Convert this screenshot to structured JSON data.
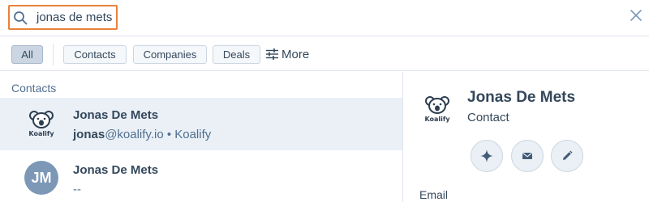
{
  "search": {
    "query": "jonas de mets"
  },
  "filters": {
    "all": "All",
    "contacts": "Contacts",
    "companies": "Companies",
    "deals": "Deals",
    "more": "More"
  },
  "results": {
    "section_label": "Contacts",
    "items": [
      {
        "name": "Jonas De Mets",
        "email_user": "jonas",
        "email_rest": "@koalify.io • Koalify",
        "logo_text": "Koalify",
        "selected": true
      },
      {
        "name": "Jonas De Mets",
        "subtitle": "--",
        "avatar_initials": "JM",
        "selected": false
      }
    ]
  },
  "preview": {
    "name": "Jonas De Mets",
    "type": "Contact",
    "logo_text": "Koalify",
    "email_label": "Email",
    "actions": [
      "sparkle-icon",
      "email-icon",
      "pencil-icon"
    ]
  },
  "colors": {
    "focus_border": "#e8823b",
    "selected_row": "#eaf0f6",
    "avatar": "#7c98b6",
    "text": "#33475b"
  }
}
